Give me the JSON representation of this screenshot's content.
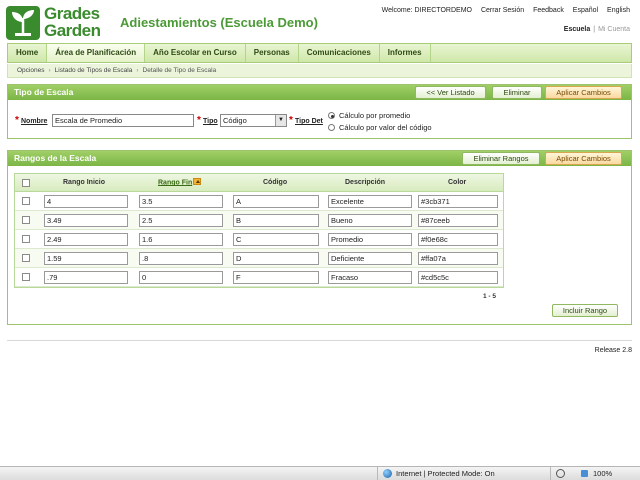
{
  "header": {
    "logo_line1": "Grades",
    "logo_line2": "Garden",
    "app_title": "Adiestamientos (Escuela Demo)",
    "welcome": "Welcome: DIRECTORDEMO",
    "links": [
      "Cerrar Sesión",
      "Feedback",
      "Español",
      "English"
    ],
    "account_current": "Escuela",
    "account_other": "Mi Cuenta"
  },
  "nav": {
    "items": [
      {
        "label": "Home"
      },
      {
        "label": "Área de Planificación"
      },
      {
        "label": "Año Escolar en Curso"
      },
      {
        "label": "Personas"
      },
      {
        "label": "Comunicaciones"
      },
      {
        "label": "Informes"
      }
    ],
    "active_index": 1
  },
  "breadcrumb": [
    "Opciones",
    "Listado de Tipos de Escala",
    "Detalle de Tipo de Escala"
  ],
  "tipo_panel": {
    "title": "Tipo de Escala",
    "buttons": {
      "ver_listado": "<< Ver Listado",
      "eliminar": "Eliminar",
      "aplicar": "Aplicar Cambios"
    },
    "nombre_label": "Nombre",
    "nombre_value": "Escala de Promedio",
    "tipo_label": "Tipo",
    "tipo_value": "Código",
    "tipodet_label": "Tipo Det",
    "radio_options": [
      "Cálculo por promedio",
      "Cálculo por valor del código"
    ],
    "radio_selected": 0
  },
  "rangos_panel": {
    "title": "Rangos de la Escala",
    "buttons": {
      "eliminar_rangos": "Eliminar Rangos",
      "aplicar": "Aplicar Cambios",
      "incluir": "Incluir Rango"
    },
    "columns": [
      "Rango Inicio",
      "Rango Fin",
      "Código",
      "Descripción",
      "Color"
    ],
    "rows": [
      {
        "inicio": "4",
        "fin": "3.5",
        "codigo": "A",
        "descripcion": "Excelente",
        "color": "#3cb371"
      },
      {
        "inicio": "3.49",
        "fin": "2.5",
        "codigo": "B",
        "descripcion": "Bueno",
        "color": "#87ceeb"
      },
      {
        "inicio": "2.49",
        "fin": "1.6",
        "codigo": "C",
        "descripcion": "Promedio",
        "color": "#f0e68c"
      },
      {
        "inicio": "1.59",
        "fin": ".8",
        "codigo": "D",
        "descripcion": "Deficiente",
        "color": "#ffa07a"
      },
      {
        "inicio": ".79",
        "fin": "0",
        "codigo": "F",
        "descripcion": "Fracaso",
        "color": "#cd5c5c"
      }
    ],
    "pager": "1 - 5"
  },
  "footer": {
    "release": "Release 2.8"
  },
  "statusbar": {
    "zone": "Internet | Protected Mode: On",
    "zoom": "100%"
  }
}
